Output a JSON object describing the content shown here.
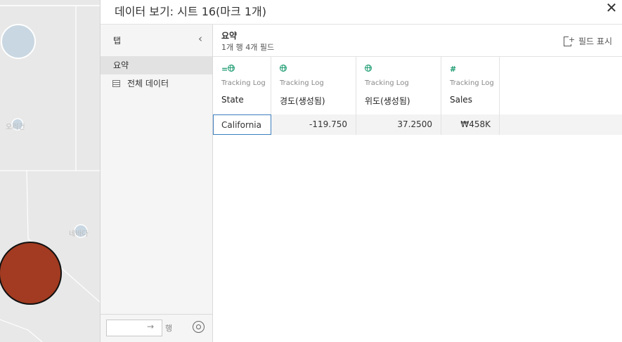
{
  "dialog": {
    "title": "데이터 보기: 시트 16(마크 1개)",
    "close_glyph": "✕"
  },
  "map": {
    "labels": [
      "오리건",
      "네바다"
    ],
    "highlight_color": "#a23b21"
  },
  "tabs_panel": {
    "header": "탭",
    "collapse_glyph": "‹",
    "items": [
      {
        "label": "요약"
      },
      {
        "label": "전체 데이터"
      }
    ],
    "rows_arrow": "→",
    "rows_label": "행"
  },
  "summary": {
    "title": "요약",
    "subtitle": "1개 행 4개 필드",
    "show_fields_label": "필드 표시"
  },
  "table": {
    "columns": [
      {
        "icon": "geo-dimension-icon",
        "source": "Tracking Log",
        "name": "State"
      },
      {
        "icon": "globe-icon",
        "source": "Tracking Log",
        "name": "경도(생성됨)"
      },
      {
        "icon": "globe-icon",
        "source": "Tracking Log",
        "name": "위도(생성됨)"
      },
      {
        "icon": "hash-icon",
        "icon_glyph": "#",
        "source": "Tracking Log",
        "name": "Sales"
      }
    ],
    "rows": [
      [
        "California",
        "-119.750",
        "37.2500",
        "₩458K"
      ]
    ]
  }
}
